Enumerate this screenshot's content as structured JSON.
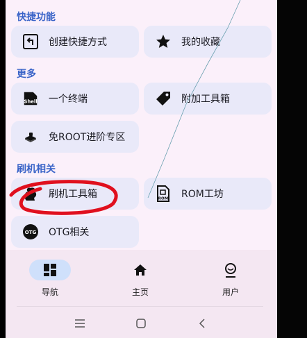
{
  "sections": [
    {
      "title": "快捷功能"
    },
    {
      "title": "更多"
    },
    {
      "title": "刷机相关"
    }
  ],
  "quick": {
    "create_shortcut": {
      "label": "创建快捷方式",
      "icon": "shortcut-icon"
    },
    "favorites": {
      "label": "我的收藏",
      "icon": "star-icon"
    }
  },
  "more": {
    "terminal": {
      "label": "一个终端",
      "icon": "shell-icon",
      "icon_text": "Shell"
    },
    "extra_toolbox": {
      "label": "附加工具箱",
      "icon": "tag-icon"
    },
    "no_root": {
      "label": "免ROOT进阶专区",
      "icon": "device-icon"
    }
  },
  "flash": {
    "flash_toolbox": {
      "label": "刷机工具箱",
      "icon": "squirrel-icon"
    },
    "rom_workshop": {
      "label": "ROM工坊",
      "icon": "rom-icon",
      "icon_text": "ROM"
    },
    "otg": {
      "label": "OTG相关",
      "icon": "otg-icon",
      "icon_text": "OTG"
    }
  },
  "nav": [
    {
      "label": "导航",
      "icon": "grid-icon",
      "active": true
    },
    {
      "label": "主页",
      "icon": "home-icon",
      "active": false
    },
    {
      "label": "用户",
      "icon": "user-icon",
      "active": false
    }
  ],
  "colors": {
    "accent": "#3a64c8",
    "card": "#e9e9f9",
    "background": "#fbf0fa",
    "annotation": "#e0101e"
  }
}
